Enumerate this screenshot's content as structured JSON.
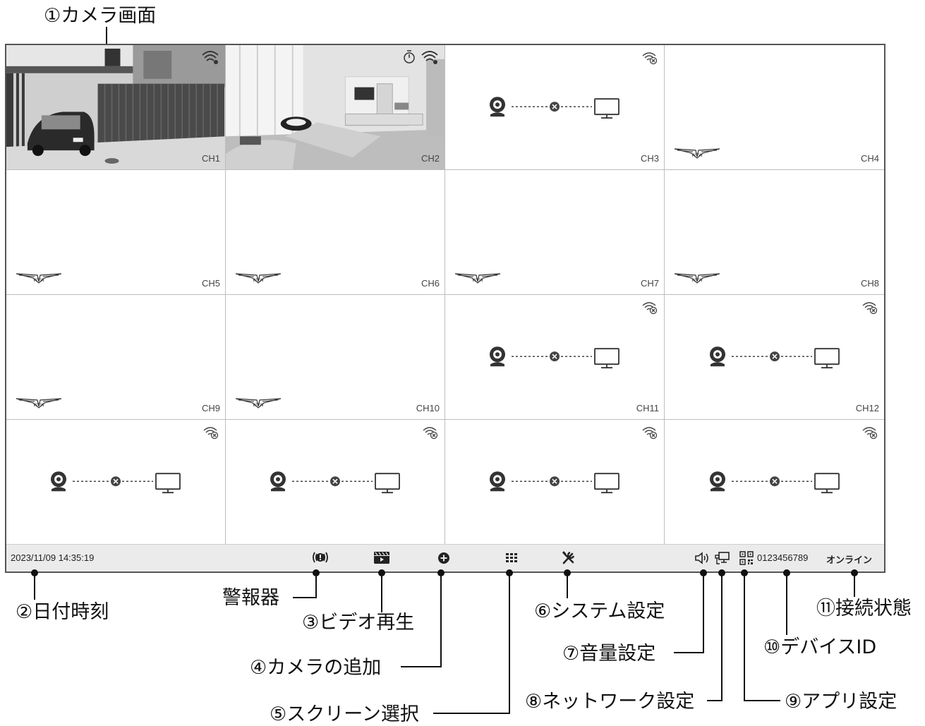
{
  "callouts": {
    "camera_screen": "①カメラ画面",
    "datetime": "②日付時刻",
    "alarm": "警報器",
    "video_playback": "③ビデオ再生",
    "add_camera": "④カメラの追加",
    "screen_select": "⑤スクリーン選択",
    "system_settings": "⑥システム設定",
    "volume_settings": "⑦音量設定",
    "network_settings": "⑧ネットワーク設定",
    "app_settings": "⑨アプリ設定",
    "device_id": "⑩デバイスID",
    "connection_status": "⑪接続状態"
  },
  "channels": [
    {
      "label": "CH1",
      "state": "live-garage"
    },
    {
      "label": "CH2",
      "state": "live-room"
    },
    {
      "label": "CH3",
      "state": "disconnected"
    },
    {
      "label": "CH4",
      "state": "logo"
    },
    {
      "label": "CH5",
      "state": "logo"
    },
    {
      "label": "CH6",
      "state": "logo"
    },
    {
      "label": "CH7",
      "state": "logo"
    },
    {
      "label": "CH8",
      "state": "logo"
    },
    {
      "label": "CH9",
      "state": "logo"
    },
    {
      "label": "CH10",
      "state": "logo"
    },
    {
      "label": "CH11",
      "state": "disconnected"
    },
    {
      "label": "CH12",
      "state": "disconnected"
    },
    {
      "label": "",
      "state": "disconnected"
    },
    {
      "label": "",
      "state": "disconnected"
    },
    {
      "label": "",
      "state": "disconnected"
    },
    {
      "label": "",
      "state": "disconnected"
    }
  ],
  "logo_text": "WTW",
  "statusbar": {
    "datetime": "2023/11/09 14:35:19",
    "device_id": "0123456789",
    "connection": "オンライン",
    "icons": [
      "alarm-icon",
      "video-playback-icon",
      "add-camera-icon",
      "screen-layout-icon",
      "system-settings-icon",
      "volume-icon",
      "network-icon",
      "qr-code-icon"
    ]
  }
}
